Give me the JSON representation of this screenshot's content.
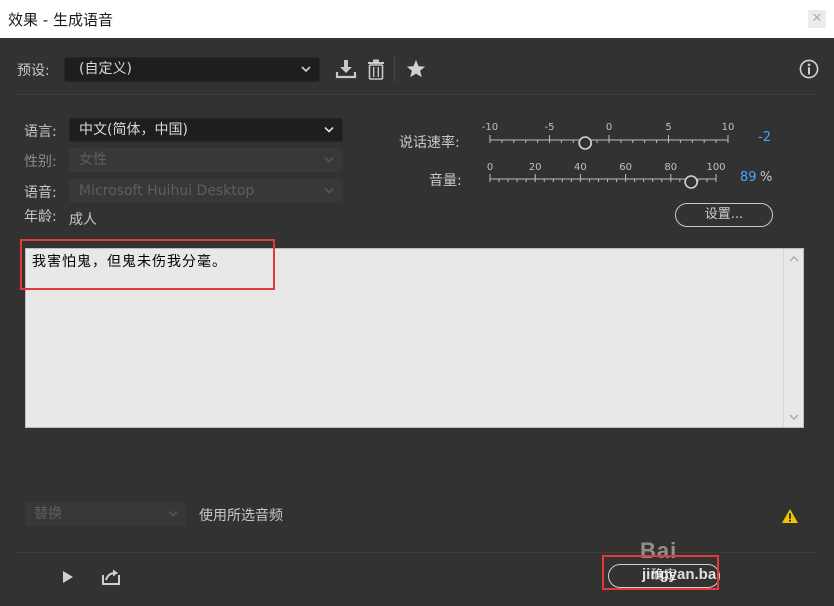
{
  "window": {
    "title": "效果 - 生成语音",
    "close_glyph": "✕"
  },
  "toolbar": {
    "preset_label": "预设:",
    "preset_value": "(自定义)",
    "icons": [
      "save-preset-icon",
      "delete-preset-icon",
      "favorite-icon",
      "info-icon"
    ]
  },
  "voice": {
    "language_label": "语言:",
    "language_value": "中文(简体，中国)",
    "gender_label": "性别:",
    "gender_value": "女性",
    "voice_label": "语音:",
    "voice_value": "Microsoft Huihui Desktop",
    "age_label": "年龄:",
    "age_value": "成人"
  },
  "speed": {
    "label": "说话速率:",
    "ticks": [
      "-10",
      "-5",
      "0",
      "5",
      "10"
    ],
    "min": -10,
    "max": 10,
    "value": -2,
    "value_text": "-2"
  },
  "volume": {
    "label": "音量:",
    "ticks": [
      "0",
      "20",
      "40",
      "60",
      "80",
      "100"
    ],
    "min": 0,
    "max": 100,
    "value": 89,
    "value_text": "89",
    "unit": "%"
  },
  "settings_button": "设置...",
  "text_input": {
    "value": "我害怕鬼，但鬼未伤我分毫。"
  },
  "footer": {
    "replace_value": "替换",
    "use_selected_audio": "使用所选音频",
    "ok_button": "确定"
  },
  "watermark": {
    "brand": "Bai",
    "url": "jingyan.ba"
  },
  "colors": {
    "accent": "#4aa3ff",
    "highlight": "#e4393c",
    "warning": "#f2c400",
    "panel": "#323232"
  }
}
